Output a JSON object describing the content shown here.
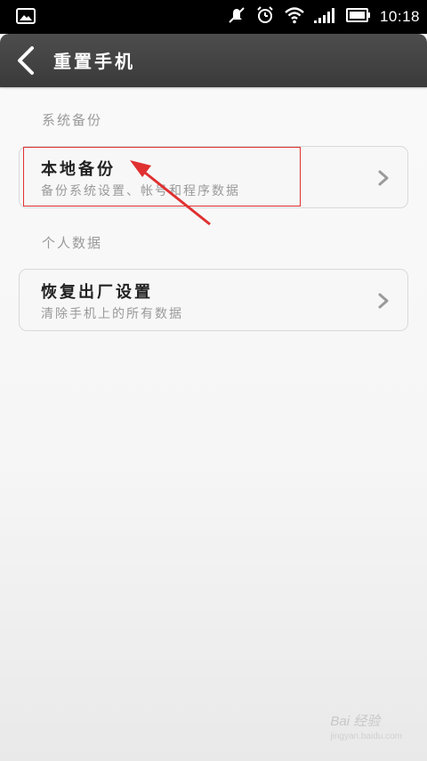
{
  "status_bar": {
    "time": "10:18",
    "icons": [
      "image-icon",
      "mute-icon",
      "alarm-icon",
      "wifi-icon",
      "signal-icon",
      "battery-icon"
    ]
  },
  "header": {
    "title": "重置手机",
    "back_icon": "chevron-left-icon"
  },
  "sections": [
    {
      "label": "系统备份",
      "item": {
        "title": "本地备份",
        "subtitle": "备份系统设置、帐号和程序数据"
      }
    },
    {
      "label": "个人数据",
      "item": {
        "title": "恢复出厂设置",
        "subtitle": "清除手机上的所有数据"
      }
    }
  ],
  "annotation": {
    "color": "#e03030"
  },
  "watermark": {
    "text": "Bai 经验",
    "sub": "jingyan.baidu.com"
  }
}
